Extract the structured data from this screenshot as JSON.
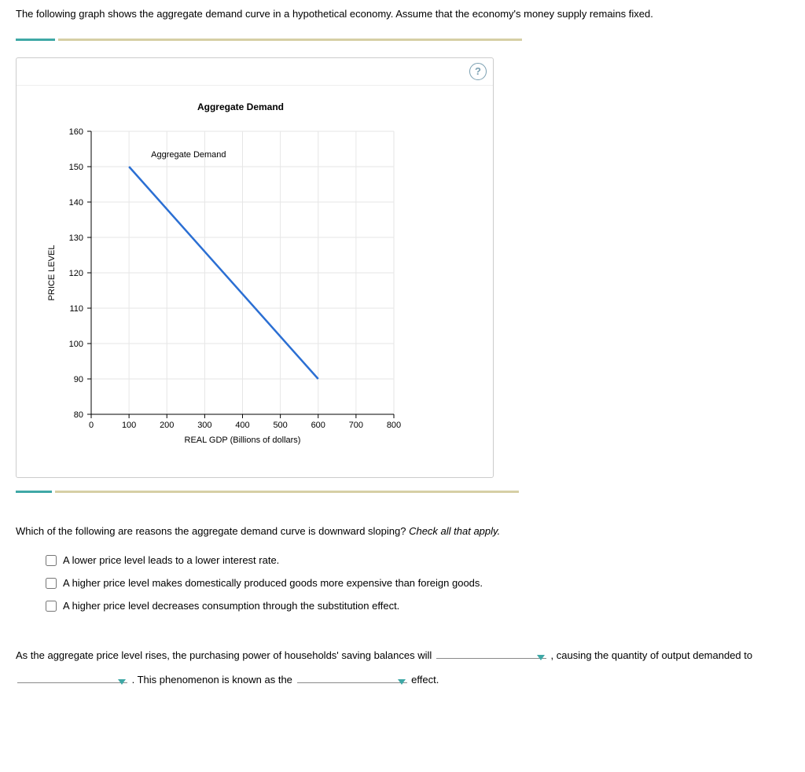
{
  "intro": "The following graph shows the aggregate demand curve in a hypothetical economy. Assume that the economy's money supply remains fixed.",
  "help": "?",
  "chart_data": {
    "type": "line",
    "title": "Aggregate Demand",
    "xlabel": "REAL GDP (Billions of dollars)",
    "ylabel": "PRICE LEVEL",
    "xlim": [
      0,
      800
    ],
    "ylim": [
      80,
      160
    ],
    "x_ticks": [
      0,
      100,
      200,
      300,
      400,
      500,
      600,
      700,
      800
    ],
    "y_ticks": [
      80,
      90,
      100,
      110,
      120,
      130,
      140,
      150,
      160
    ],
    "series": [
      {
        "name": "Aggregate Demand",
        "x": [
          100,
          600
        ],
        "y": [
          150,
          90
        ]
      }
    ]
  },
  "question": {
    "prompt_main": "Which of the following are reasons the aggregate demand curve is downward sloping? ",
    "prompt_hint": "Check all that apply.",
    "options": [
      "A lower price level leads to a lower interest rate.",
      "A higher price level makes domestically produced goods more expensive than foreign goods.",
      "A higher price level decreases consumption through the substitution effect."
    ]
  },
  "fill": {
    "part1": "As the aggregate price level rises, the purchasing power of households' saving balances will ",
    "part2": ", causing the quantity of output demanded to ",
    "part3": ". This phenomenon is known as the ",
    "part4": " effect."
  }
}
